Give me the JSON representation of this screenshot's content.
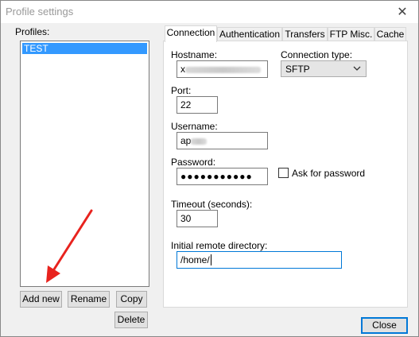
{
  "window": {
    "title": "Profile settings",
    "close_glyph": "✕"
  },
  "profiles": {
    "label": "Profiles:",
    "items": [
      "TEST"
    ],
    "buttons": {
      "add_new": "Add new",
      "rename": "Rename",
      "copy": "Copy",
      "delete": "Delete"
    }
  },
  "tabs": [
    "Connection",
    "Authentication",
    "Transfers",
    "FTP Misc.",
    "Cache"
  ],
  "connection": {
    "hostname_label": "Hostname:",
    "hostname_prefix": "x",
    "connection_type_label": "Connection type:",
    "connection_type_value": "SFTP",
    "port_label": "Port:",
    "port_value": "22",
    "username_label": "Username:",
    "username_prefix": "ap",
    "password_label": "Password:",
    "password_value": "●●●●●●●●●●●",
    "ask_password_label": "Ask for password",
    "timeout_label": "Timeout (seconds):",
    "timeout_value": "30",
    "remote_dir_label": "Initial remote directory:",
    "remote_dir_value": "/home/"
  },
  "footer": {
    "close_label": "Close"
  },
  "colors": {
    "selection": "#3399ff",
    "focus": "#0078d7",
    "annotation_arrow": "#e8231e"
  }
}
